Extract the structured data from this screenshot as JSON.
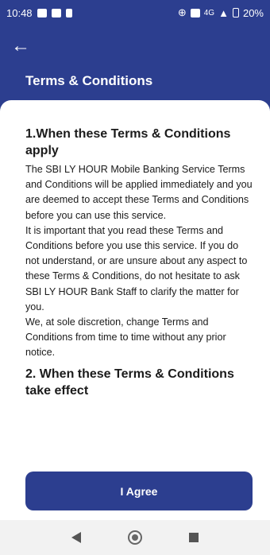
{
  "status": {
    "time": "10:48",
    "network": "4G",
    "battery": "20%"
  },
  "header": {
    "back_icon": "←",
    "title": "Terms & Conditions"
  },
  "section1": {
    "heading": "1.When these Terms & Conditions apply",
    "p1": "The SBI LY HOUR Mobile Banking Service Terms and Conditions will be applied immediately and you are deemed to accept these Terms and Conditions before you can use this service.",
    "p2": "It is important that you read these Terms and Conditions before you use this service. If you do not understand, or are unsure about any aspect to these Terms & Conditions, do not hesitate to ask SBI LY HOUR Bank Staff to clarify the matter for you.",
    "p3": "We, at sole discretion, change Terms and Conditions from time to time without any prior notice."
  },
  "section2": {
    "heading": "2. When these Terms & Conditions take effect"
  },
  "agree_button": "I Agree"
}
